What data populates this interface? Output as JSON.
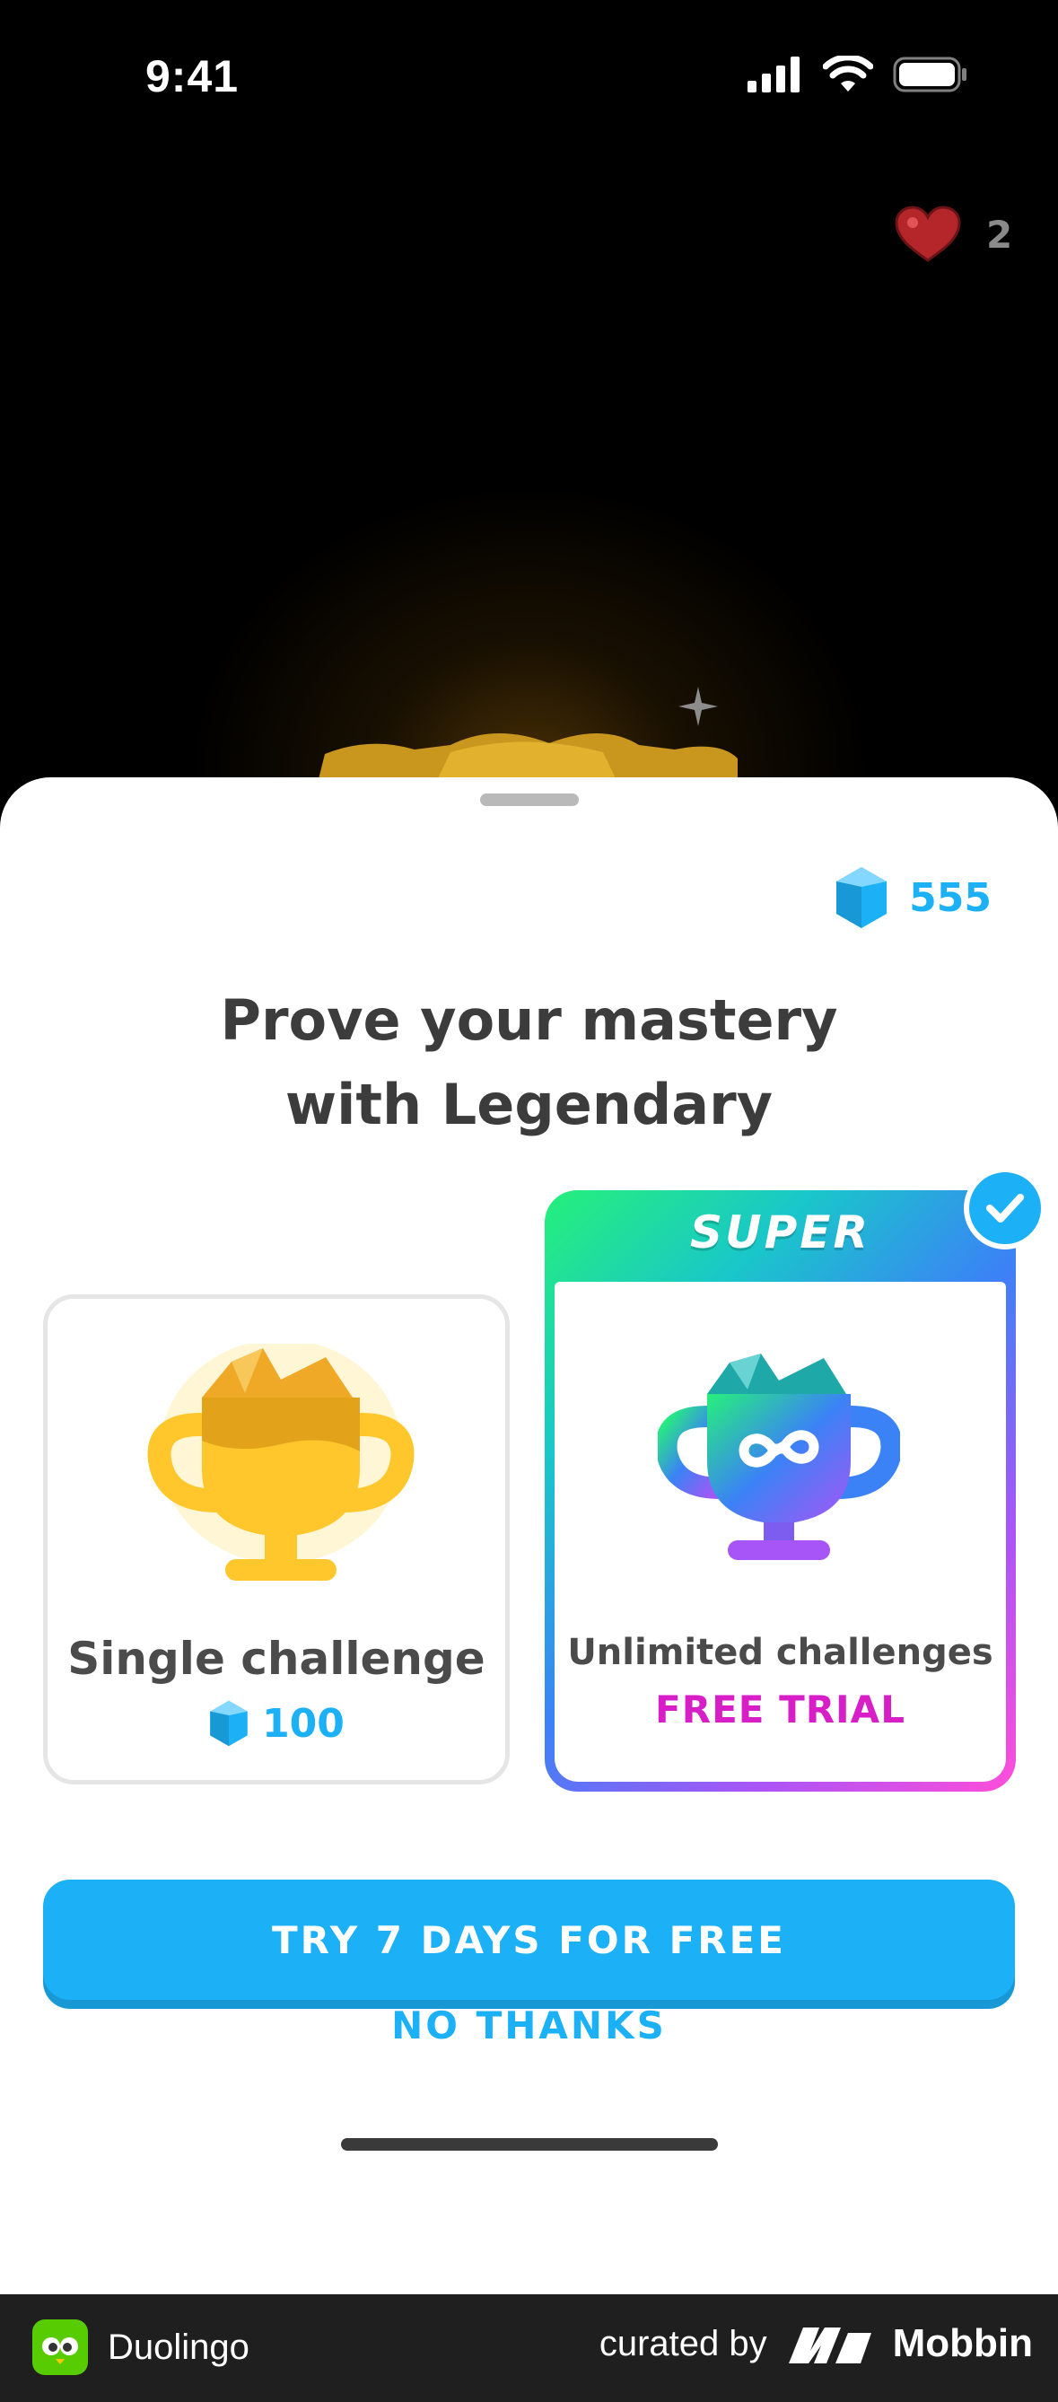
{
  "status_bar": {
    "time": "9:41"
  },
  "hearts": {
    "count": "2"
  },
  "sheet": {
    "gems": "555",
    "title_line1": "Prove your mastery",
    "title_line2": "with Legendary"
  },
  "options": [
    {
      "title": "Single challenge",
      "price": "100"
    },
    {
      "badge": "SUPER",
      "title": "Unlimited challenges",
      "subtitle": "FREE TRIAL"
    }
  ],
  "buttons": {
    "primary": "TRY 7 DAYS FOR FREE",
    "secondary": "NO THANKS"
  },
  "footer": {
    "app_name": "Duolingo",
    "curated_by": "curated by",
    "brand": "Mobbin"
  },
  "colors": {
    "accent": "#1cb0f6",
    "free_trial": "#d71ec7",
    "heart": "#ff4b4b"
  }
}
